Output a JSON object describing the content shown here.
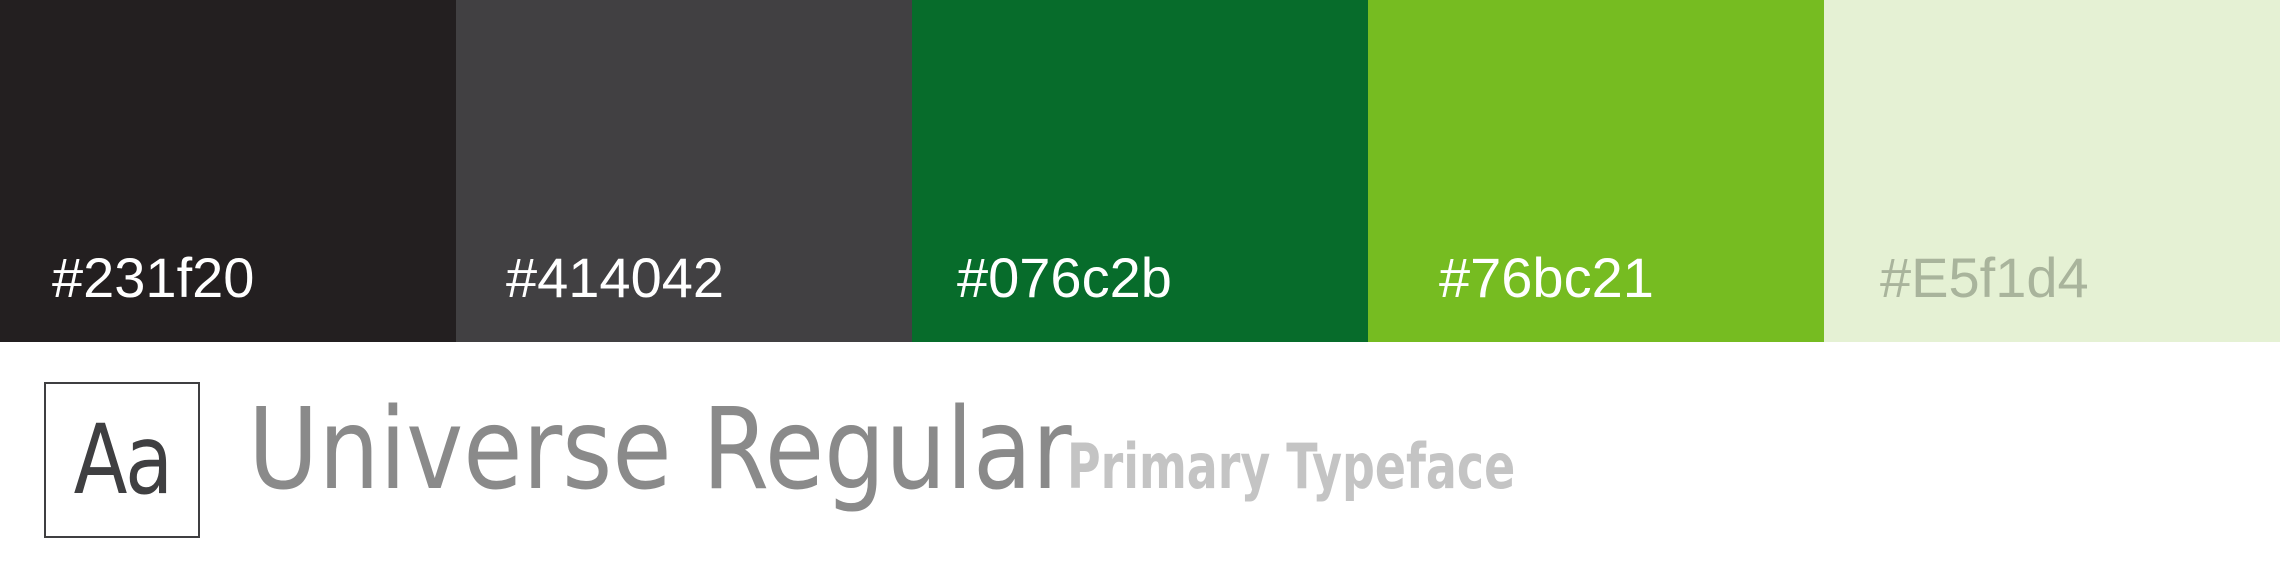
{
  "palette": {
    "swatches": [
      {
        "label": "#231f20",
        "color": "#231f20",
        "text_color": "#ffffff"
      },
      {
        "label": "#414042",
        "color": "#414042",
        "text_color": "#ffffff"
      },
      {
        "label": "#076c2b",
        "color": "#076c2b",
        "text_color": "#ffffff"
      },
      {
        "label": "#76bc21",
        "color": "#76bc21",
        "text_color": "#ffffff"
      },
      {
        "label": "#E5f1d4",
        "color": "#e5f1d4",
        "text_color": "#a9b49c"
      }
    ]
  },
  "typography": {
    "sample_glyphs": "Aa",
    "font_name": "Universe Regular",
    "font_role": "Primary Typeface"
  }
}
